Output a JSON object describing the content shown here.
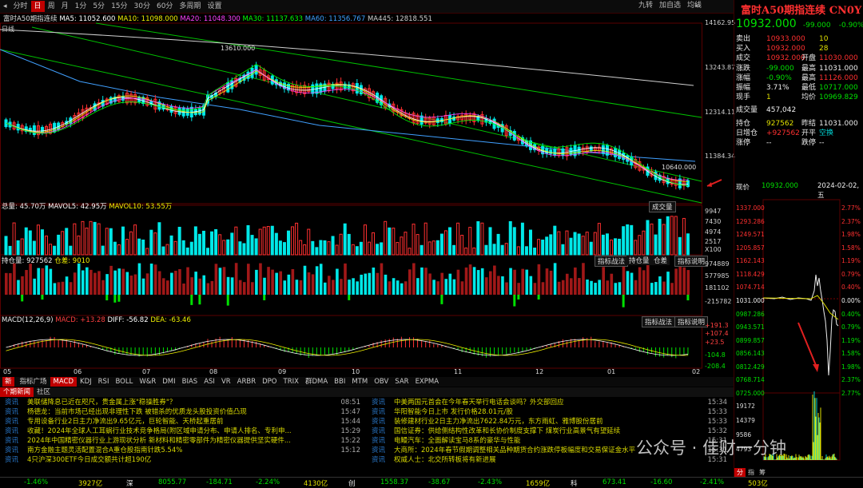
{
  "toolbar": {
    "periods": [
      "分时",
      "日",
      "周",
      "月",
      "1分",
      "5分",
      "15分",
      "30分",
      "60分",
      "多周期",
      "设置"
    ],
    "active_period": "日",
    "right_items": [
      "九转",
      "加自选",
      "均线"
    ]
  },
  "kline": {
    "legend_title": "富时A50期指连续",
    "ma_items": [
      {
        "label": "MA5: 11052.600",
        "color": "#ffffff"
      },
      {
        "label": "MA10: 11098.000",
        "color": "#f0f000"
      },
      {
        "label": "MA20: 11048.300",
        "color": "#ff40ff"
      },
      {
        "label": "MA30: 11137.633",
        "color": "#00ff00"
      },
      {
        "label": "MA60: 11356.767",
        "color": "#40a0ff"
      },
      {
        "label": "MA445: 12818.551",
        "color": "#cfcfcf"
      }
    ],
    "price_axis": [
      "14162.95",
      "13243.87",
      "12314.11",
      "11384.34"
    ],
    "left_label": "日线",
    "high_mark": "13610.000",
    "low_mark": "10640.000"
  },
  "volume": {
    "legend": "总量: 45.70万",
    "mavol5": "MAVOL5: 42.95万",
    "mavol10": "MAVOL10: 53.55万",
    "axis": [
      "9947",
      "7430",
      "4974",
      "2517",
      "X100"
    ],
    "button": "成交量"
  },
  "open_interest": {
    "legend": "持仓量: 927562",
    "increase": "仓差: 9010",
    "axis": [
      "974889",
      "577985",
      "181102",
      "-215782"
    ],
    "buttons": [
      "指标战法",
      "持仓量",
      "仓差",
      "指标说明"
    ]
  },
  "macd": {
    "legend": "MACD(12,26,9)",
    "macd": "MACD: +13.28",
    "diff": "DIFF: -56.82",
    "dea": "DEA: -63.46",
    "axis": [
      "+191.3",
      "+107.4",
      "+23.5",
      "-104.8",
      "-208.4"
    ],
    "buttons": [
      "指标战法",
      "指标说明"
    ]
  },
  "date_axis": [
    "05",
    "06",
    "07",
    "08",
    "09",
    "10",
    "11",
    "12",
    "01",
    "02"
  ],
  "indicator_tabs": [
    "新",
    "指标广场",
    "MACD",
    "KDJ",
    "RSI",
    "BOLL",
    "W&R",
    "DMI",
    "BIAS",
    "ASI",
    "VR",
    "ARBR",
    "DPO",
    "TRIX",
    "群DMA",
    "BBI",
    "MTM",
    "OBV",
    "SAR",
    "EXPMA"
  ],
  "active_indicator": "MACD",
  "news_tabs": [
    "个期新闻",
    "社区"
  ],
  "news": {
    "left": [
      {
        "tag": "资讯",
        "title": "美联储降息已近在咫尺，贵金属上涨\"稳操胜券\"？",
        "time": "08:51"
      },
      {
        "tag": "资讯",
        "title": "杨德龙：当前市场已经出现非理性下跌 被错杀的优质龙头股投资价值凸现",
        "time": "15:47"
      },
      {
        "tag": "资讯",
        "title": "专用设备行业2日主力净流出9.65亿元，巨轮智能、天桥起重居前",
        "time": "15:44"
      },
      {
        "tag": "资讯",
        "title": "收藏！2024年全球人工耳蜗行业技术竞争格局(附区域申请分布、申请人排名、专利申...",
        "time": "15:29"
      },
      {
        "tag": "资讯",
        "title": "2024年中国精密仪器行业上游现状分析 新材料和精密零部件为精密仪器提供坚实硬件...",
        "time": "15:22"
      },
      {
        "tag": "资讯",
        "title": "南方金融主题灵活配置混合A重仓股指南针跌5.54%",
        "time": "15:12"
      },
      {
        "tag": "资讯",
        "title": "4只沪深300ETF今日成交额共计超190亿",
        "time": ""
      }
    ],
    "right": [
      {
        "tag": "资讯",
        "title": "中美两国元首会在今年春天举行电话会谈吗？外交部回应",
        "time": "15:34"
      },
      {
        "tag": "资讯",
        "title": "华阳智能今日上市 发行价格28.01元/股",
        "time": "15:33"
      },
      {
        "tag": "资讯",
        "title": "装修建材行业2日主力净流出7622.84万元，东方雨虹、雅博股份居前",
        "time": "15:33"
      },
      {
        "tag": "资讯",
        "title": "国信证券：供给侧结构性改革和长协价制度支撑下 煤炭行业高景气有望延续",
        "time": "15:32"
      },
      {
        "tag": "资讯",
        "title": "电鳗汽车：全面解读宝马8系的豪华与性能",
        "time": "15:31"
      },
      {
        "tag": "资讯",
        "title": "大商所：2024年春节假期调整相关品种期货合约涨跌停板幅度和交易保证金水平",
        "time": "15:31"
      },
      {
        "tag": "资讯",
        "title": "权威人士：北交所转板将有新进展",
        "time": "15:31"
      }
    ]
  },
  "statusbar": [
    {
      "text": "-1.46%",
      "color": "green"
    },
    {
      "text": "3927亿",
      "color": "yellow"
    },
    {
      "text": "深",
      "color": "white"
    },
    {
      "text": "8055.77",
      "color": "green"
    },
    {
      "text": "-184.71",
      "color": "green"
    },
    {
      "text": "-2.24%",
      "color": "green"
    },
    {
      "text": "4130亿",
      "color": "yellow"
    },
    {
      "text": "创",
      "color": "white"
    },
    {
      "text": "1558.37",
      "color": "green"
    },
    {
      "text": "-38.67",
      "color": "green"
    },
    {
      "text": "-2.43%",
      "color": "green"
    },
    {
      "text": "1659亿",
      "color": "yellow"
    },
    {
      "text": "科",
      "color": "white"
    },
    {
      "text": "673.41",
      "color": "green"
    },
    {
      "text": "-16.60",
      "color": "green"
    },
    {
      "text": "-2.41%",
      "color": "green"
    },
    {
      "text": "503亿",
      "color": "yellow"
    }
  ],
  "quote": {
    "title": "富时A50期指连续 CN0Y",
    "last": "10932.000",
    "change": "-99.000",
    "change_pct": "-0.90%",
    "rows": [
      {
        "l1": "卖出",
        "v1": "10933.000",
        "v1c": "red",
        "l2": "",
        "v2": "10",
        "v2c": "yellow"
      },
      {
        "l1": "买入",
        "v1": "10932.000",
        "v1c": "red",
        "l2": "",
        "v2": "28",
        "v2c": "yellow"
      },
      {
        "l1": "成交",
        "v1": "10932.000",
        "v1c": "red",
        "l2": "开盘",
        "v2": "11030.000",
        "v2c": "red"
      },
      {
        "l1": "涨跌",
        "v1": "-99.000",
        "v1c": "green",
        "l2": "最高",
        "v2": "11031.000",
        "v2c": "white"
      },
      {
        "l1": "涨幅",
        "v1": "-0.90%",
        "v1c": "green",
        "l2": "最高",
        "v2": "11126.000",
        "v2c": "red"
      },
      {
        "l1": "振幅",
        "v1": "3.71%",
        "v1c": "white",
        "l2": "最低",
        "v2": "10717.000",
        "v2c": "green"
      },
      {
        "l1": "现手",
        "v1": "1",
        "v1c": "yellow",
        "l2": "均价",
        "v2": "10969.829",
        "v2c": "green"
      },
      {
        "l1": "成交量",
        "v1": "457,042",
        "v1c": "white",
        "l2": "",
        "v2": "",
        "v2c": "white"
      },
      {
        "l1": "持仓",
        "v1": "927562",
        "v1c": "yellow",
        "l2": "昨结",
        "v2": "11031.000",
        "v2c": "white"
      },
      {
        "l1": "日增仓",
        "v1": "+927562",
        "v1c": "red",
        "l2": "开平",
        "v2": "空换",
        "v2c": "cyan"
      },
      {
        "l1": "涨停",
        "v1": "--",
        "v1c": "white",
        "l2": "跌停",
        "v2": "--",
        "v2c": "white"
      }
    ],
    "now_label": "现价",
    "now_value": "10932.000",
    "date": "2024-02-02,五"
  },
  "intraday": {
    "price_axis": [
      "1337.000",
      "1293.286",
      "1249.571",
      "1205.857",
      "1162.143",
      "1118.429",
      "1074.714",
      "1031.000",
      "0987.286",
      "0943.571",
      "0899.857",
      "0856.143",
      "0812.429",
      "0768.714",
      "0725.000"
    ],
    "pct_axis": [
      "2.77%",
      "2.37%",
      "1.98%",
      "1.58%",
      "1.19%",
      "0.79%",
      "0.40%",
      "0.00%",
      "0.40%",
      "0.79%",
      "1.19%",
      "1.58%",
      "1.98%",
      "2.37%",
      "2.77%"
    ],
    "vol_axis": [
      "19172",
      "14379",
      "9586",
      "4793"
    ],
    "tabs": [
      "分",
      "指",
      "筹"
    ]
  },
  "watermark": "公众号 · 佳财一分钟"
}
